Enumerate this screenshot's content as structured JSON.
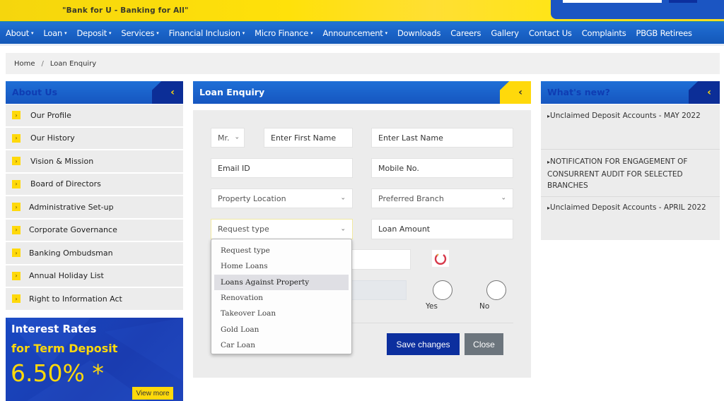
{
  "header": {
    "tagline": "\"Bank for U - Banking for All\""
  },
  "nav": {
    "items": [
      {
        "label": "About",
        "dropdown": true
      },
      {
        "label": "Loan",
        "dropdown": true
      },
      {
        "label": "Deposit",
        "dropdown": true
      },
      {
        "label": "Services",
        "dropdown": true
      },
      {
        "label": "Financial Inclusion",
        "dropdown": true
      },
      {
        "label": "Micro Finance",
        "dropdown": true
      },
      {
        "label": "Announcement",
        "dropdown": true
      },
      {
        "label": "Downloads",
        "dropdown": false
      },
      {
        "label": "Careers",
        "dropdown": false
      },
      {
        "label": "Gallery",
        "dropdown": false
      },
      {
        "label": "Contact Us",
        "dropdown": false
      },
      {
        "label": "Complaints",
        "dropdown": false
      },
      {
        "label": "PBGB Retirees",
        "dropdown": false
      }
    ],
    "caret": "▾"
  },
  "breadcrumb": {
    "home": "Home",
    "separator": "/",
    "current": "Loan Enquiry"
  },
  "sidebar": {
    "title": "About Us",
    "collapse_icon": "‹",
    "bullet": "›",
    "items": [
      {
        "label": "Our Profile"
      },
      {
        "label": "Our History"
      },
      {
        "label": "Vision & Mission"
      },
      {
        "label": "Board of Directors"
      },
      {
        "label": "Administrative Set-up"
      },
      {
        "label": "Corporate Governance"
      },
      {
        "label": "Banking Ombudsman"
      },
      {
        "label": "Annual Holiday List"
      },
      {
        "label": "Right to Information Act"
      }
    ]
  },
  "promo": {
    "line1": "Interest Rates",
    "line2": "for Term Deposit",
    "rate": "6.50% *",
    "button": "View more"
  },
  "form": {
    "title": "Loan Enquiry",
    "collapse_icon": "‹",
    "salutation": {
      "value": "Mr."
    },
    "first_name": {
      "placeholder": "Enter First Name"
    },
    "last_name": {
      "placeholder": "Enter Last Name"
    },
    "email": {
      "placeholder": "Email ID"
    },
    "mobile": {
      "placeholder": "Mobile No."
    },
    "property_location": {
      "value": "Property Location"
    },
    "preferred_branch": {
      "value": "Preferred Branch"
    },
    "request_type": {
      "value": "Request type",
      "options": [
        "Request type",
        "Home Loans",
        "Loans Against Property",
        "Renovation",
        "Takeover Loan",
        "Gold Loan",
        "Car Loan"
      ],
      "highlighted": "Loans Against Property"
    },
    "loan_amount": {
      "placeholder": "Loan Amount"
    },
    "captcha_input": {
      "placeholder": ""
    },
    "radio_yes": "Yes",
    "radio_no": "No",
    "save_button": "Save changes",
    "close_button": "Close"
  },
  "whats_new": {
    "title": "What's new?",
    "collapse_icon": "‹",
    "bullet": "▸",
    "items": [
      "Unclaimed Deposit Accounts - MAY 2022",
      "NOTIFICATION FOR ENGAGEMENT OF CONSURRENT AUDIT FOR SELECTED BRANCHES",
      "Unclaimed Deposit Accounts - APRIL 2022"
    ]
  },
  "colors": {
    "brand_yellow": "#ffd90b",
    "brand_blue": "#1a63c7",
    "dark_blue": "#0c2f9e",
    "close_grey": "#6c757d"
  }
}
